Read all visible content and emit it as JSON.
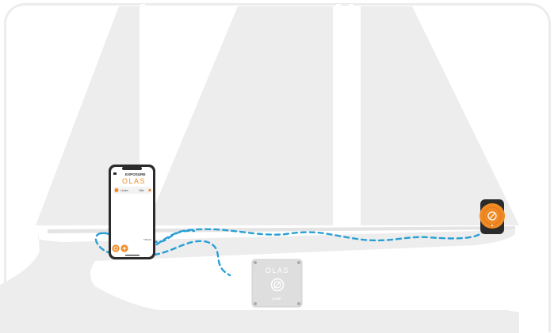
{
  "phone": {
    "brand": "EXPOSURE",
    "app_logo": "OLAS",
    "list_label_1": "Linden",
    "list_label_2": "Ollie",
    "footer_label": "TRACK"
  },
  "core": {
    "logo": "OLAS",
    "label": "CORE"
  },
  "colors": {
    "accent": "#f08a24",
    "link_line": "#2a9fd6",
    "boat": "#ededed",
    "device_dark": "#2b2b2b"
  },
  "icons": {
    "phone_button_left": "olas-logo-icon",
    "phone_button_right": "plus-icon",
    "tag": "olas-logo-icon"
  }
}
